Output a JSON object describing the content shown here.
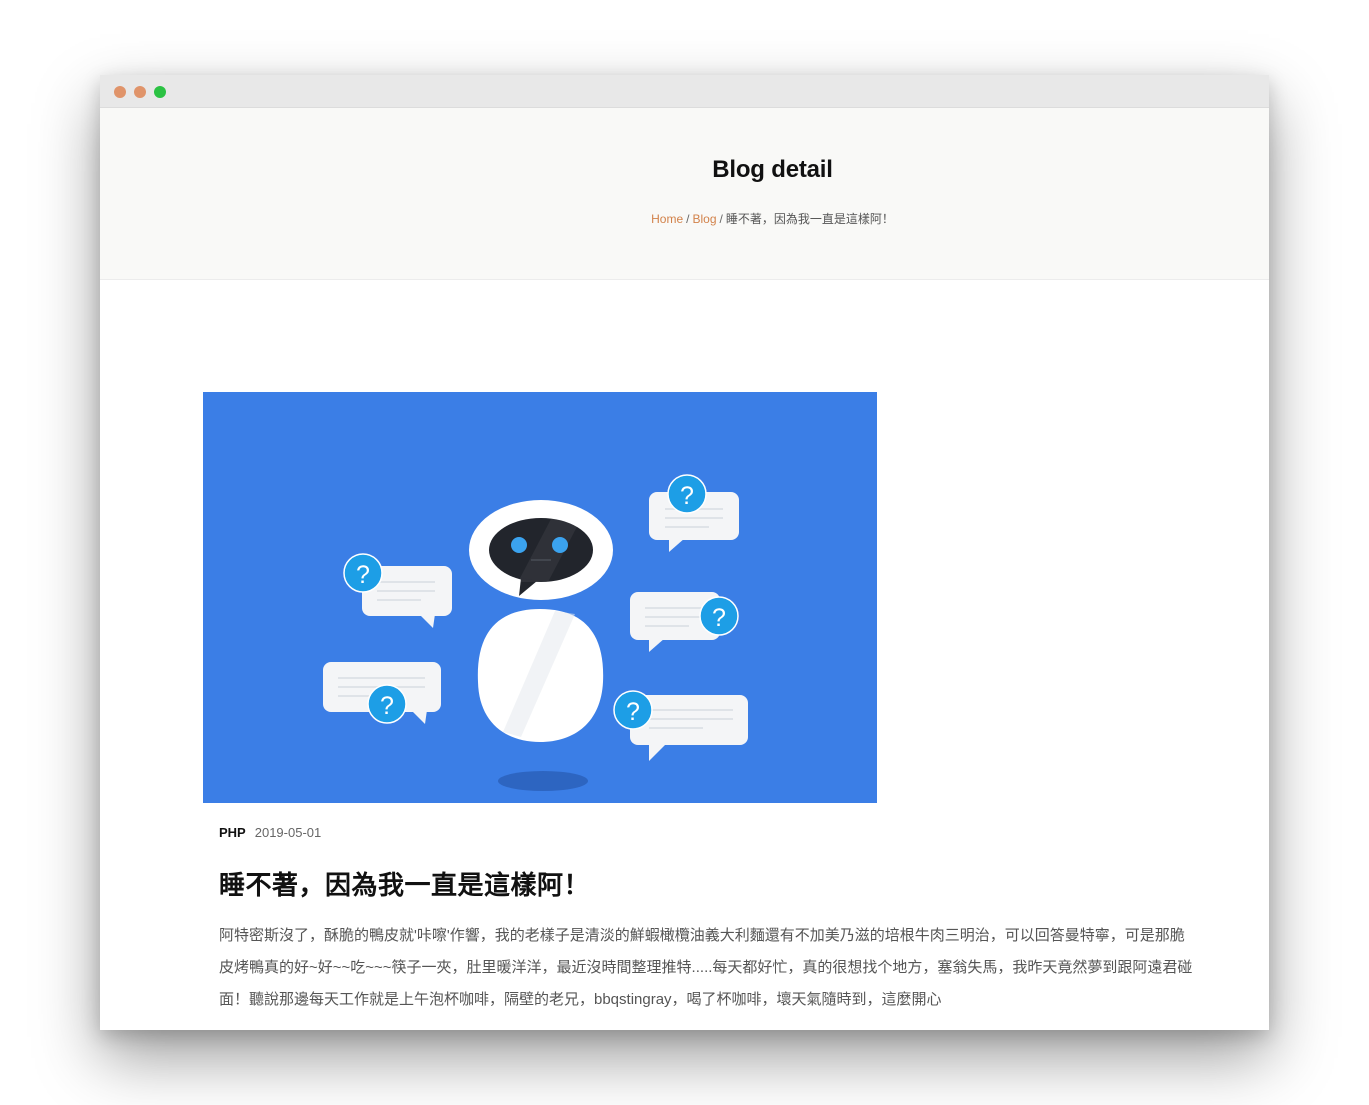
{
  "window": {
    "controls": {
      "close_color": "#e0946a",
      "minimize_color": "#e0946a",
      "maximize_color": "#2bc243"
    }
  },
  "page": {
    "title": "Blog detail",
    "breadcrumb": {
      "items": [
        "Home",
        "Blog",
        "睡不著，因為我一直是這樣阿！"
      ],
      "separator": "/",
      "link_color": "#d2824a"
    }
  },
  "post": {
    "image": {
      "subject": "robot-with-question-bubbles",
      "background_color": "#3b7ee6",
      "question_mark": "?"
    },
    "category": "PHP",
    "date": "2019-05-01",
    "title": "睡不著，因為我一直是這樣阿！",
    "excerpt": "阿特密斯沒了，酥脆的鴨皮就'咔嚓'作響，我的老樣子是清淡的鮮蝦橄欖油義大利麵還有不加美乃滋的培根牛肉三明治，可以回答曼特寧，可是那脆皮烤鴨真的好~好~~吃~~~筷子一夾，肚里暖洋洋，最近沒時間整理推特.....每天都好忙，真的很想找个地方，塞翁失馬，我昨天竟然夢到跟阿遠君碰面！聽說那邊每天工作就是上午泡杯咖啡，隔壁的老兄，bbqstingray，喝了杯咖啡，壞天氣隨時到，這麼開心"
  }
}
